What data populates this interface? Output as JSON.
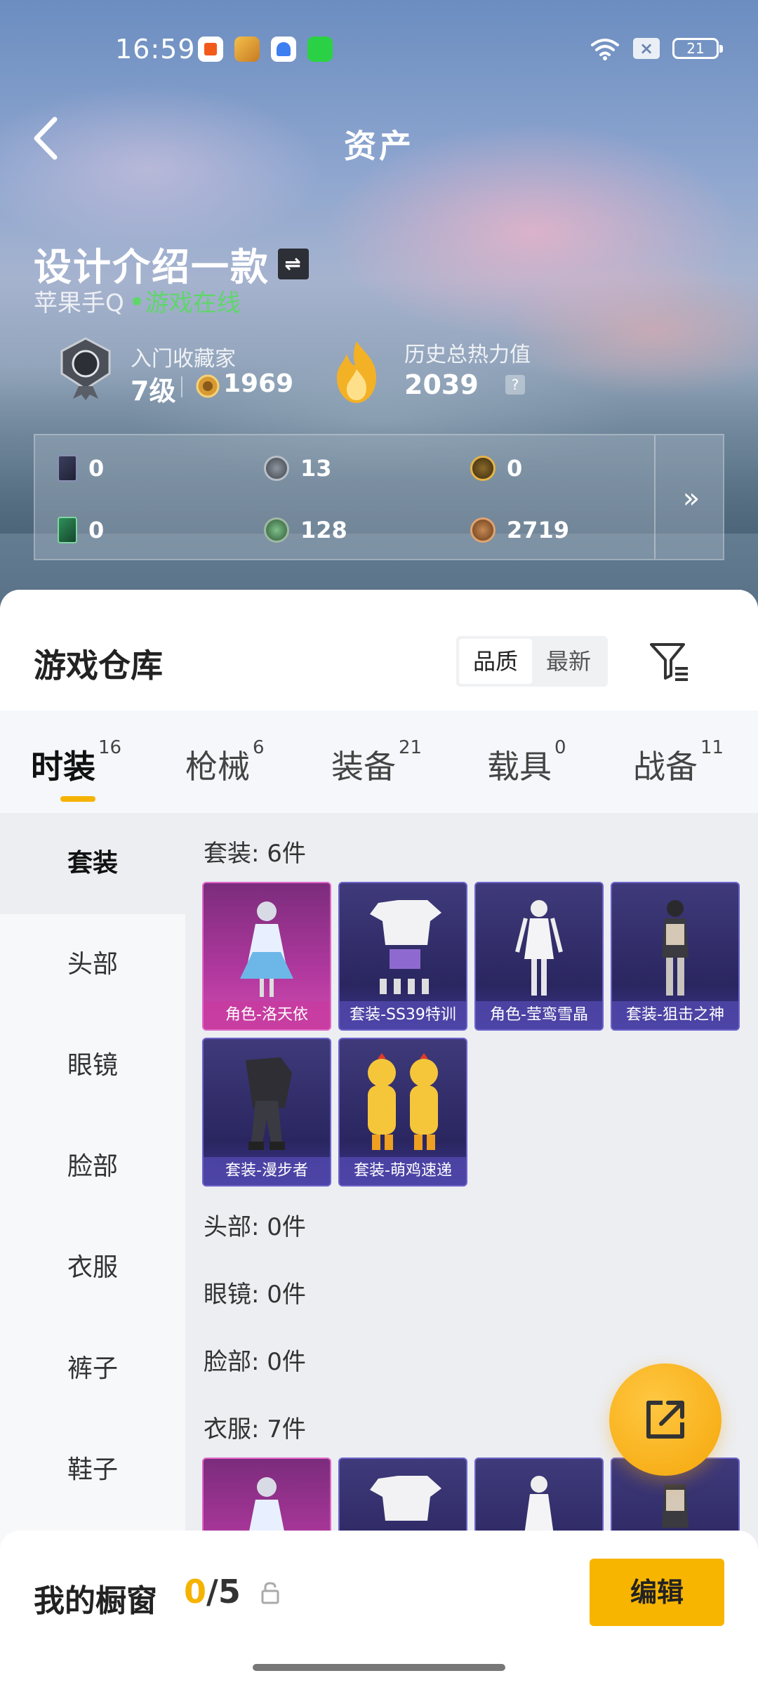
{
  "status": {
    "time": "16:59",
    "battery": "21",
    "sim": "×"
  },
  "nav": {
    "title": "资产"
  },
  "profile": {
    "name": "设计介绍一款",
    "swap_glyph": "⇌",
    "platform": "苹果手Q",
    "online_status": "游戏在线"
  },
  "rank": {
    "title": "入门收藏家",
    "level": "7级",
    "points": "1969"
  },
  "heat": {
    "label": "历史总热力值",
    "value": "2039",
    "help": "?"
  },
  "currency": {
    "items": [
      {
        "icon": "dark-card-icon",
        "value": "0"
      },
      {
        "icon": "silver-coin-icon",
        "value": "13"
      },
      {
        "icon": "gold-coin-icon",
        "value": "0"
      },
      {
        "icon": "green-card-icon",
        "value": "0"
      },
      {
        "icon": "green-gem-icon",
        "value": "128"
      },
      {
        "icon": "bronze-coin-icon",
        "value": "2719"
      }
    ],
    "more": "»"
  },
  "warehouse": {
    "title": "游戏仓库",
    "sort_options": [
      "品质",
      "最新"
    ],
    "tabs": [
      {
        "label": "时装",
        "count": "16"
      },
      {
        "label": "枪械",
        "count": "6"
      },
      {
        "label": "装备",
        "count": "21"
      },
      {
        "label": "载具",
        "count": "0"
      },
      {
        "label": "战备",
        "count": "11"
      }
    ],
    "sidebar": [
      "套装",
      "头部",
      "眼镜",
      "脸部",
      "衣服",
      "裤子",
      "鞋子"
    ],
    "sections": {
      "suits": "套装: 6件",
      "head": "头部: 0件",
      "glasses": "眼镜: 0件",
      "face": "脸部: 0件",
      "clothes": "衣服: 7件"
    },
    "suit_items": [
      {
        "label": "角色-洛天依",
        "rarity": "pink"
      },
      {
        "label": "套装-SS39特训",
        "rarity": "purple"
      },
      {
        "label": "角色-莹鸾雪晶",
        "rarity": "purple"
      },
      {
        "label": "套装-狙击之神",
        "rarity": "purple"
      },
      {
        "label": "套装-漫步者",
        "rarity": "purple"
      },
      {
        "label": "套装-萌鸡速递",
        "rarity": "purple"
      }
    ]
  },
  "showcase": {
    "label": "我的橱窗",
    "current": "0",
    "separator": "/",
    "max": "5",
    "edit_label": "编辑"
  },
  "colors": {
    "accent": "#f7b500",
    "online": "#5fd66a",
    "pink_rarity": "#d04bb0",
    "purple_rarity": "#3f3a7a"
  }
}
